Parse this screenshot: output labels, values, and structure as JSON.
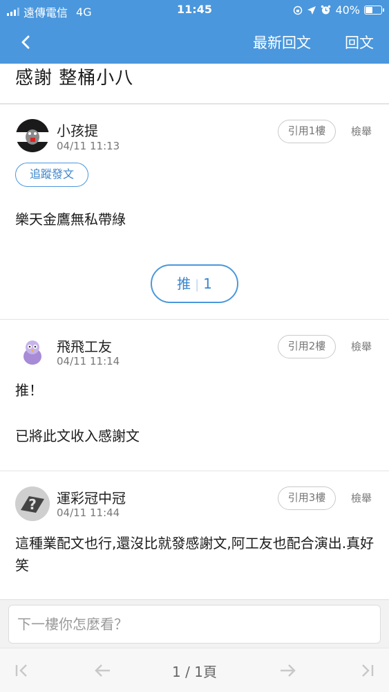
{
  "status_bar": {
    "carrier": "遠傳電信",
    "network": "4G",
    "time": "11:45",
    "battery": "40%"
  },
  "nav": {
    "latest_label": "最新回文",
    "reply_label": "回文"
  },
  "thread": {
    "title": "感謝 整桶小八"
  },
  "posts": [
    {
      "author": "小孩提",
      "time": "04/11 11:13",
      "quote_label": "引用1樓",
      "report_label": "檢舉",
      "follow_label": "追蹤發文",
      "body": [
        "樂天金鷹無私帶綠"
      ],
      "push_label": "推",
      "push_count": "1"
    },
    {
      "author": "飛飛工友",
      "time": "04/11 11:14",
      "quote_label": "引用2樓",
      "report_label": "檢舉",
      "body": [
        "推！",
        "已將此文收入感謝文"
      ]
    },
    {
      "author": "運彩冠中冠",
      "time": "04/11 11:44",
      "quote_label": "引用3樓",
      "report_label": "檢舉",
      "body": [
        "這種業配文也行,還沒比就發感謝文,阿工友也配合演出.真好笑"
      ]
    }
  ],
  "reply_input": {
    "placeholder": "下一樓你怎麼看？"
  },
  "pagination": {
    "text": "1 / 1頁"
  },
  "colors": {
    "primary": "#4a97dd",
    "divider": "#e3e3e3"
  }
}
